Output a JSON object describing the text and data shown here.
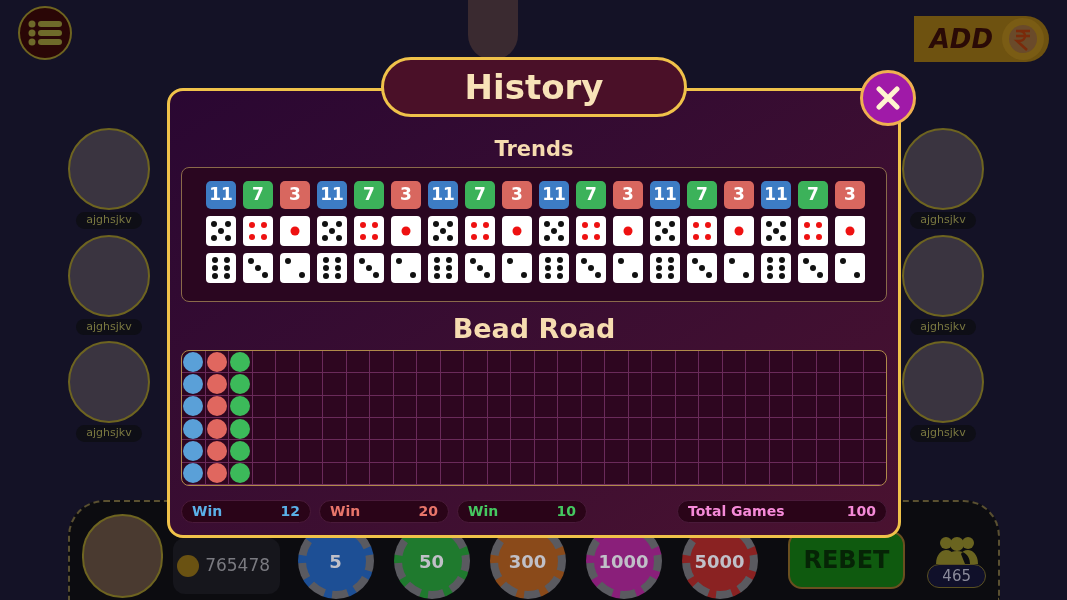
{
  "add_button": {
    "label": "ADD"
  },
  "players_left": [
    {
      "name": "ajghsjkv"
    },
    {
      "name": "ajghsjkv"
    },
    {
      "name": "ajghsjkv"
    }
  ],
  "players_right": [
    {
      "name": "ajghsjkv"
    },
    {
      "name": "ajghsjkv"
    },
    {
      "name": "ajghsjkv"
    }
  ],
  "history_dialog": {
    "title": "History",
    "trends": {
      "title": "Trends",
      "columns": [
        {
          "sum": "11",
          "color": "#3d7cc4",
          "dice": [
            {
              "kind": "five"
            },
            {
              "kind": "six"
            }
          ]
        },
        {
          "sum": "7",
          "color": "#3cb25a",
          "dice": [
            {
              "kind": "four"
            },
            {
              "kind": "three"
            }
          ]
        },
        {
          "sum": "3",
          "color": "#d8675f",
          "dice": [
            {
              "kind": "one"
            },
            {
              "kind": "two"
            }
          ]
        },
        {
          "sum": "11",
          "color": "#3d7cc4",
          "dice": [
            {
              "kind": "five"
            },
            {
              "kind": "six"
            }
          ]
        },
        {
          "sum": "7",
          "color": "#3cb25a",
          "dice": [
            {
              "kind": "four"
            },
            {
              "kind": "three"
            }
          ]
        },
        {
          "sum": "3",
          "color": "#d8675f",
          "dice": [
            {
              "kind": "one"
            },
            {
              "kind": "two"
            }
          ]
        },
        {
          "sum": "11",
          "color": "#3d7cc4",
          "dice": [
            {
              "kind": "five"
            },
            {
              "kind": "six"
            }
          ]
        },
        {
          "sum": "7",
          "color": "#3cb25a",
          "dice": [
            {
              "kind": "four"
            },
            {
              "kind": "three"
            }
          ]
        },
        {
          "sum": "3",
          "color": "#d8675f",
          "dice": [
            {
              "kind": "one"
            },
            {
              "kind": "two"
            }
          ]
        },
        {
          "sum": "11",
          "color": "#3d7cc4",
          "dice": [
            {
              "kind": "five"
            },
            {
              "kind": "six"
            }
          ]
        },
        {
          "sum": "7",
          "color": "#3cb25a",
          "dice": [
            {
              "kind": "four"
            },
            {
              "kind": "three"
            }
          ]
        },
        {
          "sum": "3",
          "color": "#d8675f",
          "dice": [
            {
              "kind": "one"
            },
            {
              "kind": "two"
            }
          ]
        },
        {
          "sum": "11",
          "color": "#3d7cc4",
          "dice": [
            {
              "kind": "five"
            },
            {
              "kind": "six"
            }
          ]
        },
        {
          "sum": "7",
          "color": "#3cb25a",
          "dice": [
            {
              "kind": "four"
            },
            {
              "kind": "three"
            }
          ]
        },
        {
          "sum": "3",
          "color": "#d8675f",
          "dice": [
            {
              "kind": "one"
            },
            {
              "kind": "two"
            }
          ]
        },
        {
          "sum": "11",
          "color": "#3d7cc4",
          "dice": [
            {
              "kind": "five"
            },
            {
              "kind": "six"
            }
          ]
        },
        {
          "sum": "7",
          "color": "#3cb25a",
          "dice": [
            {
              "kind": "four"
            },
            {
              "kind": "three"
            }
          ]
        },
        {
          "sum": "3",
          "color": "#d8675f",
          "dice": [
            {
              "kind": "one"
            },
            {
              "kind": "two"
            }
          ]
        }
      ]
    },
    "bead_road": {
      "title": "Bead Road",
      "columns": [
        {
          "beads": [
            {
              "color": "#5aa0d8"
            },
            {
              "color": "#5aa0d8"
            },
            {
              "color": "#5aa0d8"
            },
            {
              "color": "#5aa0d8"
            },
            {
              "color": "#5aa0d8"
            },
            {
              "color": "#5aa0d8"
            }
          ]
        },
        {
          "beads": [
            {
              "color": "#e0675f"
            },
            {
              "color": "#e0675f"
            },
            {
              "color": "#e0675f"
            },
            {
              "color": "#e0675f"
            },
            {
              "color": "#e0675f"
            },
            {
              "color": "#e0675f"
            }
          ]
        },
        {
          "beads": [
            {
              "color": "#3cba5a"
            },
            {
              "color": "#3cba5a"
            },
            {
              "color": "#3cba5a"
            },
            {
              "color": "#3cba5a"
            },
            {
              "color": "#3cba5a"
            },
            {
              "color": "#3cba5a"
            }
          ]
        }
      ]
    },
    "stats": [
      {
        "kind": "win",
        "label": "Win",
        "value": "12",
        "color": "#5ab0e8"
      },
      {
        "kind": "win",
        "label": "Win",
        "value": "20",
        "color": "#e8756a"
      },
      {
        "kind": "win",
        "label": "Win",
        "value": "10",
        "color": "#45c860"
      },
      {
        "kind": "total",
        "label": "Total Games",
        "value": "100",
        "color": "#f58ad8"
      }
    ]
  },
  "bottom_bar": {
    "balance": "765478",
    "chips": [
      {
        "label": "5",
        "color": "#1d4f95"
      },
      {
        "label": "50",
        "color": "#1f7a2e"
      },
      {
        "label": "300",
        "color": "#8a4a1a"
      },
      {
        "label": "1000",
        "color": "#8a1f7a"
      },
      {
        "label": "5000",
        "color": "#8a2222"
      }
    ],
    "rebet_label": "REBET",
    "online_count": "465"
  }
}
